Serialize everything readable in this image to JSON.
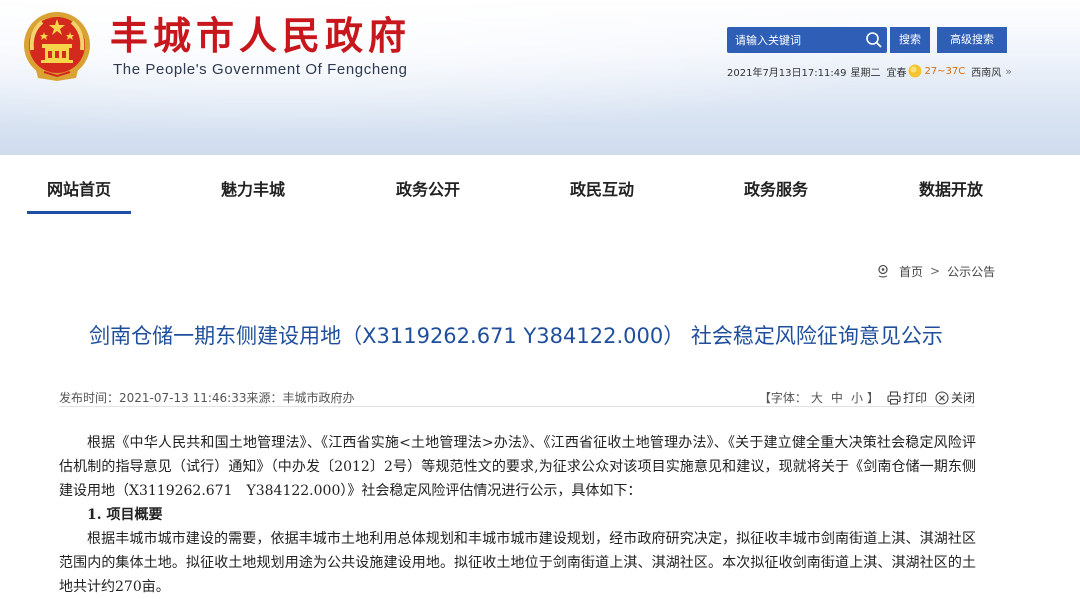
{
  "header": {
    "title_cn": "丰城市人民政府",
    "title_en": "The People's Government Of Fengcheng",
    "search_placeholder": "请输入关键词",
    "search_button": "搜索",
    "advanced_search_button": "高级搜索",
    "datetime": "2021年7月13日17:11:49",
    "weekday": "星期二",
    "city": "宜春",
    "temperature": "27~37C",
    "wind": "西南风",
    "weather_icon": "sun-icon",
    "more_icon": "chevron-double-right-icon"
  },
  "nav": {
    "items": [
      {
        "label": "网站首页",
        "active": true
      },
      {
        "label": "魅力丰城"
      },
      {
        "label": "政务公开"
      },
      {
        "label": "政民互动"
      },
      {
        "label": "政务服务"
      },
      {
        "label": "数据开放"
      }
    ]
  },
  "breadcrumb": {
    "icon": "location-icon",
    "home": "首页",
    "separator": ">",
    "current": "公示公告"
  },
  "article": {
    "title": "剑南仓储一期东侧建设用地（X3119262.671 Y384122.000） 社会稳定风险征询意见公示",
    "meta": {
      "published_label": "发布时间：",
      "published_time": "2021-07-13 11:46:33",
      "source_label": "来源：",
      "source": "丰城市政府办",
      "font_label_open": "【字体：",
      "font_large": "大",
      "font_medium": "中",
      "font_small": "小",
      "font_label_close": "】",
      "print_label": "打印",
      "close_label": "关闭",
      "print_icon": "printer-icon",
      "close_icon": "close-icon"
    },
    "paragraph1": "根据《中华人民共和国土地管理法》、《江西省实施<土地管理法>办法》、《江西省征收土地管理办法》、《关于建立健全重大决策社会稳定风险评估机制的指导意见（试行）通知》（中办发〔2012〕2号）等规范性文的要求,为征求公众对该项目实施意见和建议，现就将关于《剑南仓储一期东侧建设用地（X3119262.671　Y384122.000）》社会稳定风险评估情况进行公示，具体如下：",
    "section1_heading": "1. 项目概要",
    "paragraph2": "根据丰城市城市建设的需要，依据丰城市土地利用总体规划和丰城市城市建设规划，经市政府研究决定，拟征收丰城市剑南街道上淇、淇湖社区范围内的集体土地。拟征收土地规划用途为公共设施建设用地。拟征收土地位于剑南街道上淇、淇湖社区。本次拟征收剑南街道上淇、淇湖社区的土地共计约270亩。"
  },
  "colors": {
    "title_red": "#c8161d",
    "primary_blue": "#2e5eb6",
    "article_title_blue": "#1f4f9c",
    "nav_underline": "#1e4ea8"
  }
}
